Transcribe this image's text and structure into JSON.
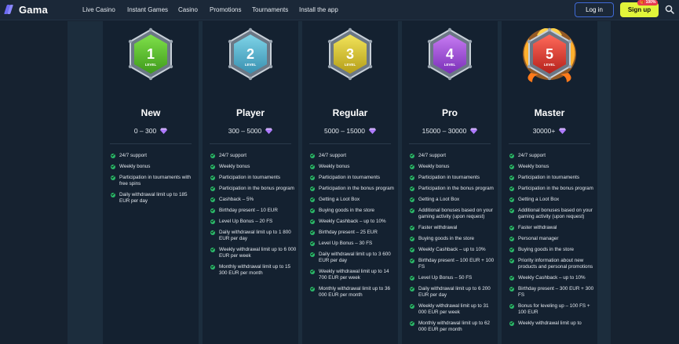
{
  "header": {
    "logo_text": "Gama",
    "nav": [
      {
        "label": "Live Casino"
      },
      {
        "label": "Instant Games"
      },
      {
        "label": "Casino"
      },
      {
        "label": "Promotions"
      },
      {
        "label": "Tournaments"
      },
      {
        "label": "Install the app"
      }
    ],
    "login_label": "Log in",
    "signup_label": "Sign up",
    "signup_badge": "🎁 100%"
  },
  "colors": {
    "background": "#162230",
    "card": "#142130",
    "accent_yellow": "#e1f53a",
    "check_green": "#2bb86a",
    "diamond": "#b07cff"
  },
  "levels": [
    {
      "number": "1",
      "badge_caption": "LEVEL",
      "name": "New",
      "points": "0 – 300",
      "color_light": "#7fe14a",
      "color_dark": "#3f9a1b",
      "frame": "plain",
      "features": [
        "24/7 support",
        "Weekly bonus",
        "Participation in tournaments with free spins",
        "Daily withdrawal limit up to 185 EUR per day"
      ]
    },
    {
      "number": "2",
      "badge_caption": "LEVEL",
      "name": "Player",
      "points": "300 – 5000",
      "color_light": "#7fd4e8",
      "color_dark": "#3890b0",
      "frame": "plain",
      "features": [
        "24/7 support",
        "Weekly bonus",
        "Participation in tournaments",
        "Participation in the bonus program",
        "Cashback – 5%",
        "Birthday present – 10 EUR",
        "Level Up Bonus – 20 FS",
        "Daily withdrawal limit up to 1 800 EUR per day",
        "Weekly withdrawal limit up to 6 000 EUR per week",
        "Monthly withdrawal limit up to 15 300 EUR per month"
      ]
    },
    {
      "number": "3",
      "badge_caption": "LEVEL",
      "name": "Regular",
      "points": "5000 – 15000",
      "color_light": "#f2e45a",
      "color_dark": "#b49d18",
      "frame": "plain",
      "features": [
        "24/7 support",
        "Weekly bonus",
        "Participation in tournaments",
        "Participation in the bonus program",
        "Getting a Loot Box",
        "Buying goods in the store",
        "Weekly Cashback – up to 10%",
        "Birthday present – 25 EUR",
        "Level Up Bonus – 30 FS",
        "Daily withdrawal limit up to 3 600 EUR per day",
        "Weekly withdrawal limit up to 14 700 EUR per week",
        "Monthly withdrawal limit up to 36 000 EUR per month"
      ]
    },
    {
      "number": "4",
      "badge_caption": "LEVEL",
      "name": "Pro",
      "points": "15000 – 30000",
      "color_light": "#c77cf2",
      "color_dark": "#7a2fb8",
      "frame": "flame-purple",
      "features": [
        "24/7 support",
        "Weekly bonus",
        "Participation in tournaments",
        "Participation in the bonus program",
        "Getting a Loot Box",
        "Additional bonuses based on your gaming activity (upon request)",
        "Faster withdrawal",
        "Buying goods in the store",
        "Weekly Cashback – up to 10%",
        "Birthday present – 100 EUR + 100 FS",
        "Level Up Bonus – 50 FS",
        "Daily withdrawal limit up to 6 200 EUR per day",
        "Weekly withdrawal limit up to 31 000 EUR per week",
        "Monthly withdrawal limit up to 62 000 EUR per month"
      ]
    },
    {
      "number": "5",
      "badge_caption": "LEVEL",
      "name": "Master",
      "points": "30000+",
      "color_light": "#ff6a5a",
      "color_dark": "#b5211c",
      "frame": "flame-fire",
      "features": [
        "24/7 support",
        "Weekly bonus",
        "Participation in tournaments",
        "Participation in the bonus program",
        "Getting a Loot Box",
        "Additional bonuses based on your gaming activity (upon request)",
        "Faster withdrawal",
        "Personal manager",
        "Buying goods in the store",
        "Priority information about new products and personal promotions",
        "Weekly Cashback – up to 10%",
        "Birthday present – 300 EUR + 300 FS",
        "Bonus for leveling up – 100 FS + 100 EUR",
        "Weekly withdrawal limit up to"
      ]
    }
  ]
}
